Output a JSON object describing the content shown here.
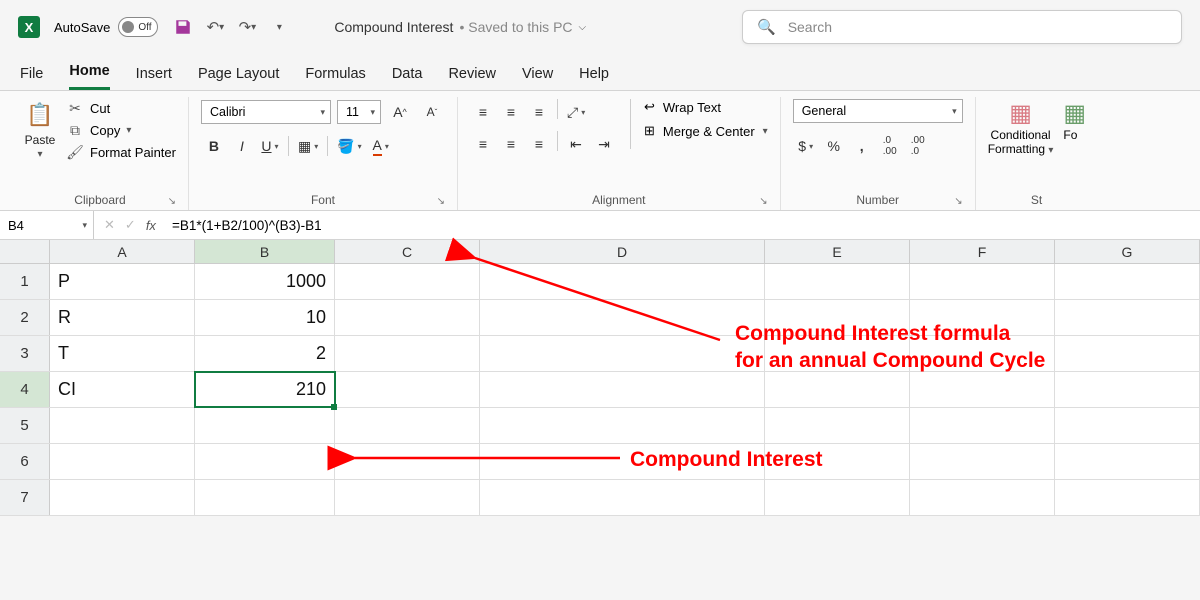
{
  "titlebar": {
    "autosave_label": "AutoSave",
    "autosave_state": "Off",
    "doc_name": "Compound Interest",
    "doc_status": "• Saved to this PC",
    "search_placeholder": "Search"
  },
  "tabs": [
    "File",
    "Home",
    "Insert",
    "Page Layout",
    "Formulas",
    "Data",
    "Review",
    "View",
    "Help"
  ],
  "active_tab": "Home",
  "ribbon": {
    "clipboard": {
      "paste": "Paste",
      "cut": "Cut",
      "copy": "Copy",
      "fmtpaint": "Format Painter",
      "label": "Clipboard"
    },
    "font": {
      "name": "Calibri",
      "size": "11",
      "label": "Font"
    },
    "alignment": {
      "wrap": "Wrap Text",
      "merge": "Merge & Center",
      "label": "Alignment"
    },
    "number": {
      "format": "General",
      "label": "Number"
    },
    "styles": {
      "cond": "Conditional",
      "cond2": "Formatting",
      "fmt": "Fo"
    }
  },
  "formula_bar": {
    "cell_ref": "B4",
    "formula": "=B1*(1+B2/100)^(B3)-B1"
  },
  "grid": {
    "columns": [
      "A",
      "B",
      "C",
      "D",
      "E",
      "F",
      "G"
    ],
    "rows": [
      {
        "n": "1",
        "A": "P",
        "B": "1000"
      },
      {
        "n": "2",
        "A": "R",
        "B": "10"
      },
      {
        "n": "3",
        "A": "T",
        "B": "2"
      },
      {
        "n": "4",
        "A": "CI",
        "B": "210"
      },
      {
        "n": "5",
        "A": "",
        "B": ""
      },
      {
        "n": "6",
        "A": "",
        "B": ""
      },
      {
        "n": "7",
        "A": "",
        "B": ""
      }
    ],
    "selected": "B4"
  },
  "annotations": {
    "line1": "Compound Interest formula",
    "line2": "for an annual Compound Cycle",
    "line3": "Compound Interest"
  }
}
